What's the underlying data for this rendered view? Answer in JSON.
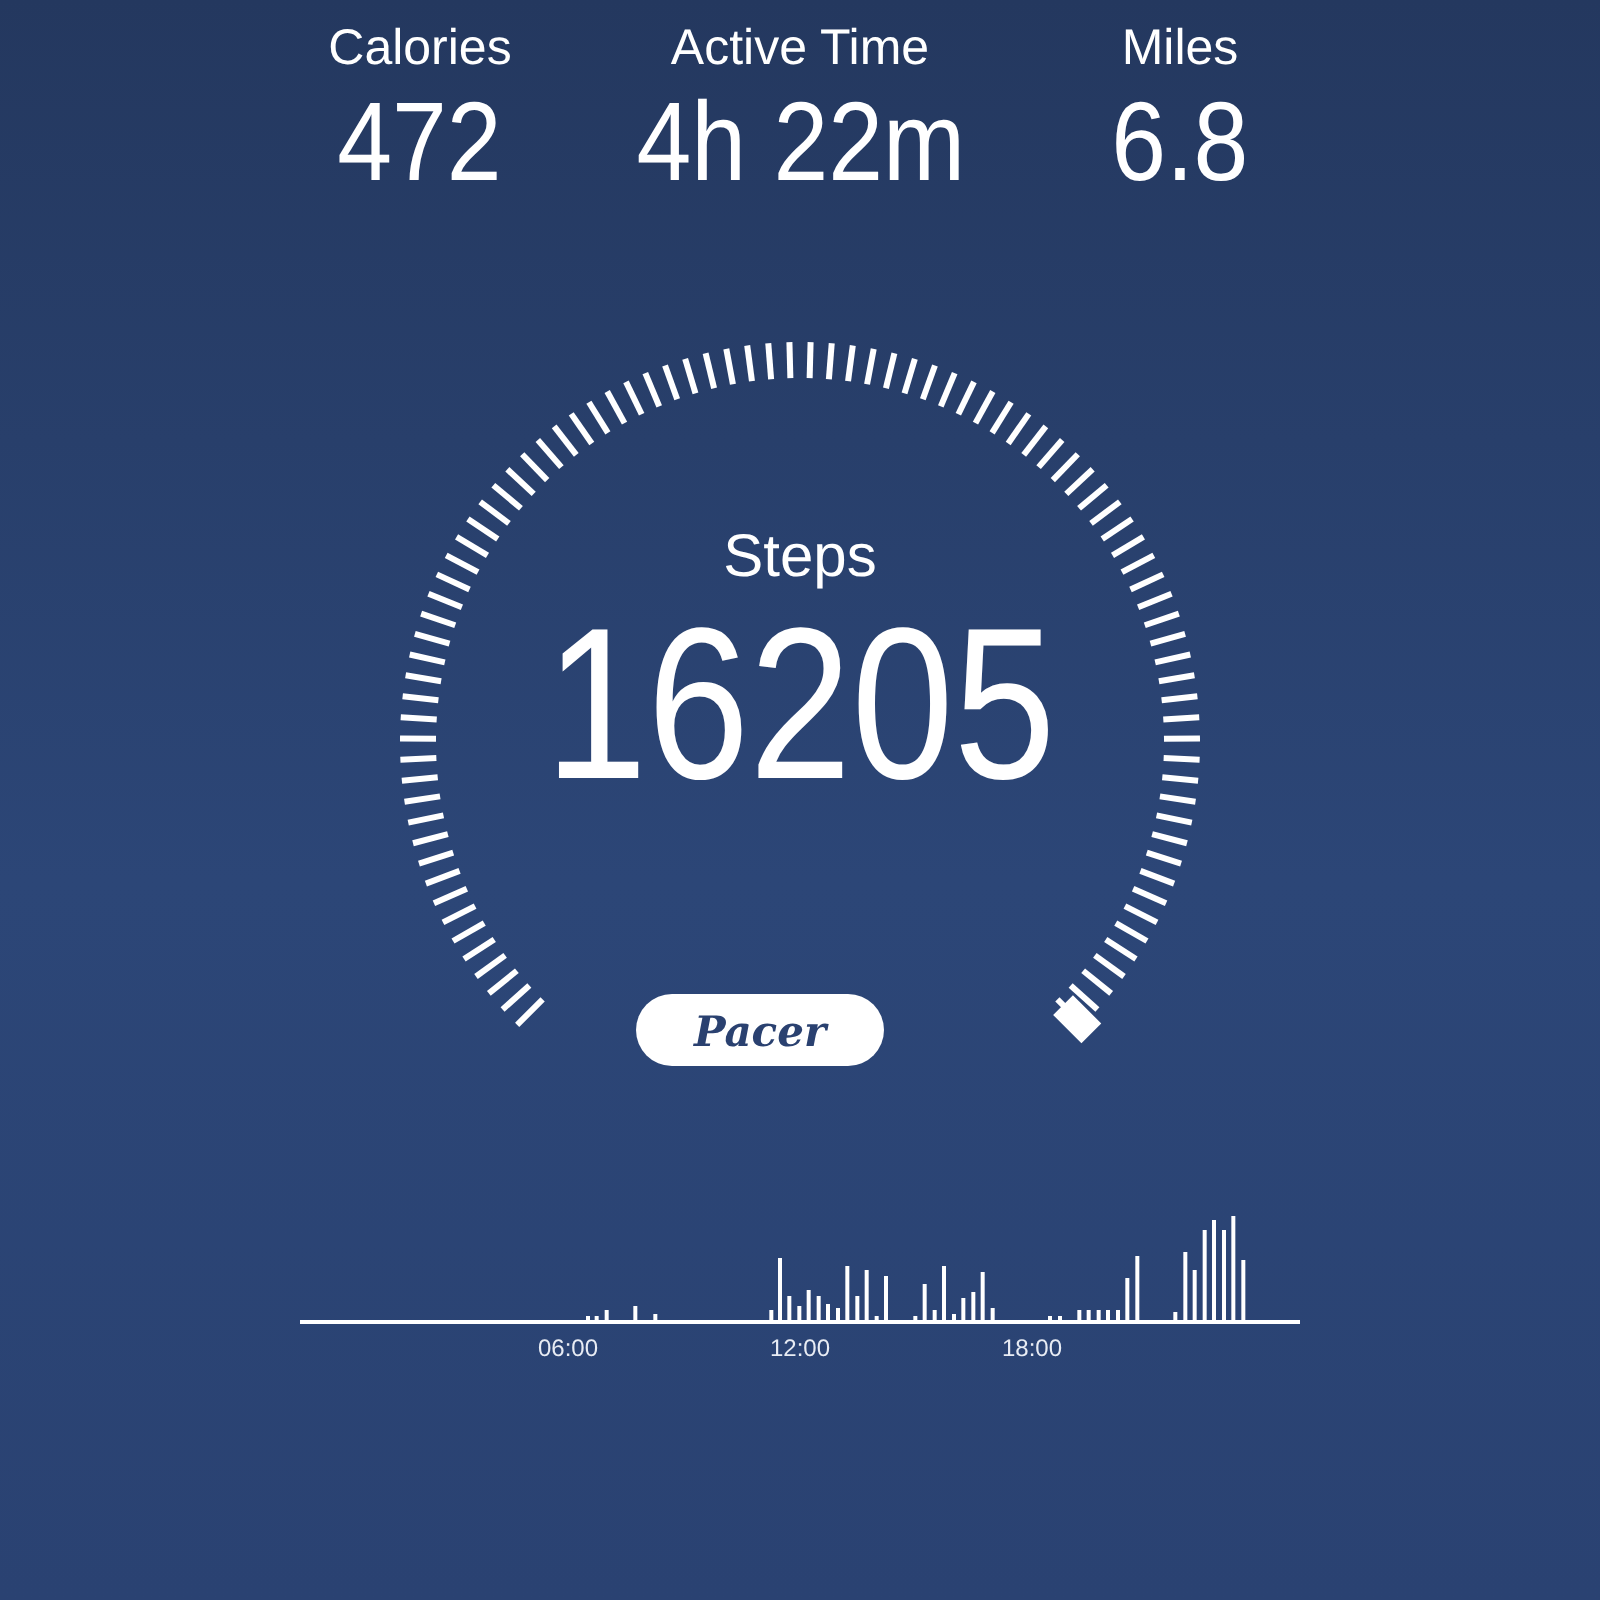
{
  "stats": [
    {
      "label": "Calories",
      "value": "472"
    },
    {
      "label": "Active Time",
      "value": "4h 22m"
    },
    {
      "label": "Miles",
      "value": "6.8"
    }
  ],
  "gauge": {
    "label": "Steps",
    "value": "16205"
  },
  "logo": {
    "text": "Pacer"
  },
  "activity": {
    "time_labels": [
      "06:00",
      "12:00",
      "18:00"
    ]
  }
}
